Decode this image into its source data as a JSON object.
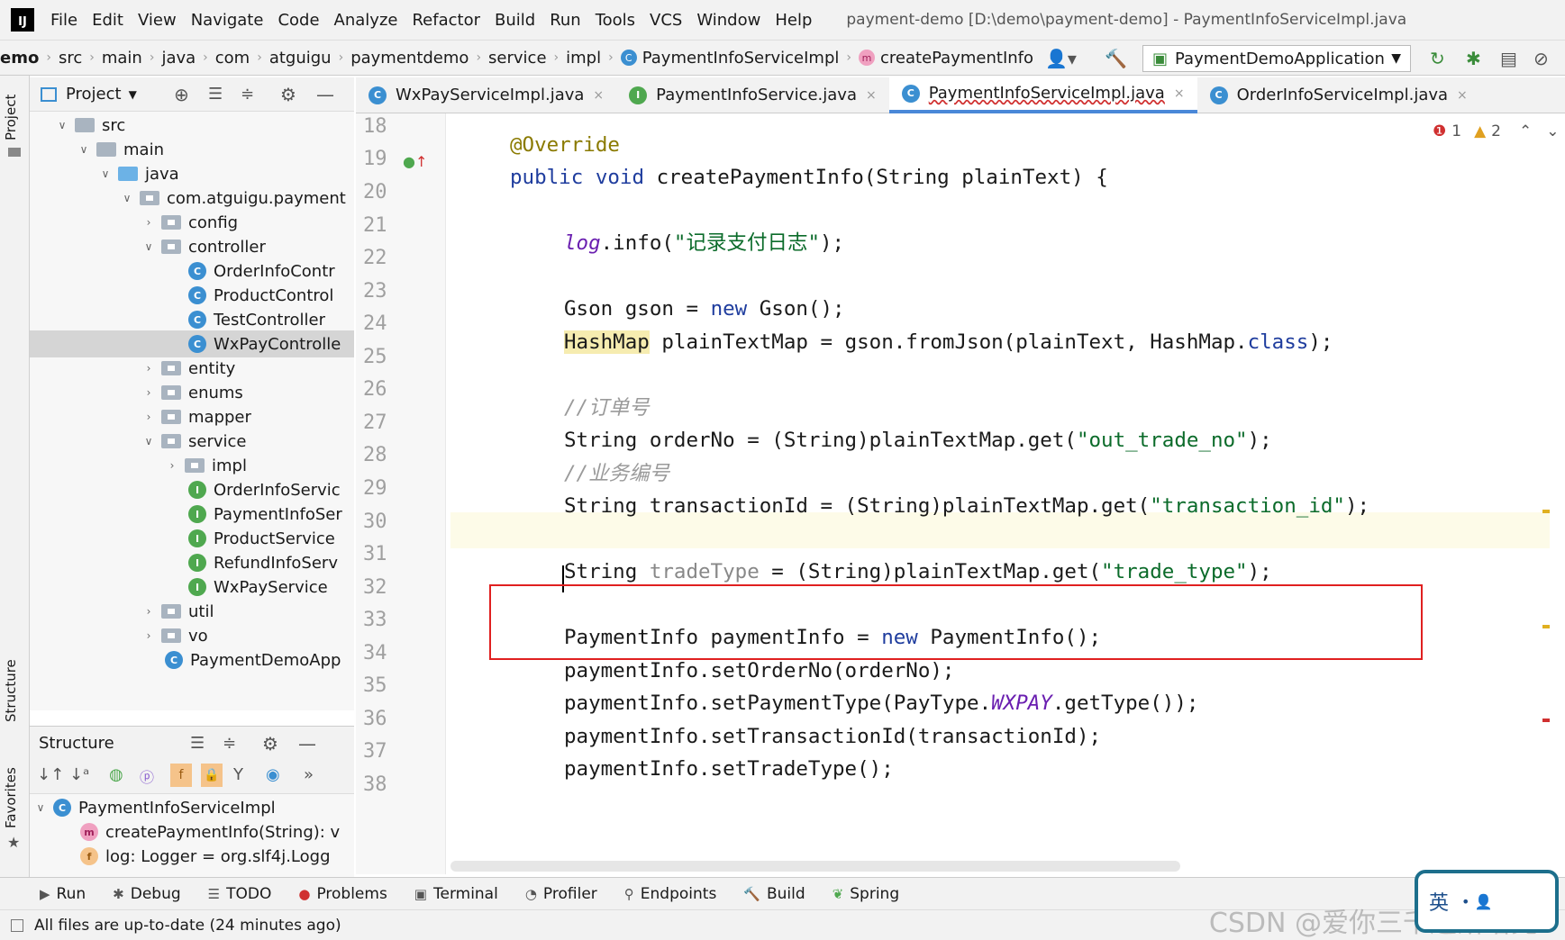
{
  "menubar": {
    "logo": "IJ",
    "items": [
      "File",
      "Edit",
      "View",
      "Navigate",
      "Code",
      "Analyze",
      "Refactor",
      "Build",
      "Run",
      "Tools",
      "VCS",
      "Window",
      "Help"
    ],
    "window_title": "payment-demo [D:\\demo\\payment-demo] - PaymentInfoServiceImpl.java"
  },
  "breadcrumb": [
    "emo",
    "src",
    "main",
    "java",
    "com",
    "atguigu",
    "paymentdemo",
    "service",
    "impl",
    "PaymentInfoServiceImpl",
    "createPaymentInfo"
  ],
  "run_config": "PaymentDemoApplication",
  "project": {
    "title": "Project",
    "rows": [
      {
        "label": "src",
        "depth": 1
      },
      {
        "label": "main",
        "depth": 2
      },
      {
        "label": "java",
        "depth": 3
      },
      {
        "label": "com.atguigu.payment",
        "depth": 4
      },
      {
        "label": "config",
        "depth": 5
      },
      {
        "label": "controller",
        "depth": 5
      },
      {
        "label": "OrderInfoContr",
        "depth": 6
      },
      {
        "label": "ProductControl",
        "depth": 6
      },
      {
        "label": "TestController",
        "depth": 6
      },
      {
        "label": "WxPayControlle",
        "depth": 6
      },
      {
        "label": "entity",
        "depth": 5
      },
      {
        "label": "enums",
        "depth": 5
      },
      {
        "label": "mapper",
        "depth": 5
      },
      {
        "label": "service",
        "depth": 5
      },
      {
        "label": "impl",
        "depth": 6
      },
      {
        "label": "OrderInfoServic",
        "depth": 6
      },
      {
        "label": "PaymentInfoSer",
        "depth": 6
      },
      {
        "label": "ProductService",
        "depth": 6
      },
      {
        "label": "RefundInfoServ",
        "depth": 6
      },
      {
        "label": "WxPayService",
        "depth": 6
      },
      {
        "label": "util",
        "depth": 5
      },
      {
        "label": "vo",
        "depth": 5
      },
      {
        "label": "PaymentDemoApp",
        "depth": 5
      }
    ]
  },
  "left_stripe": {
    "project": "Project",
    "structure": "Structure",
    "favorites": "Favorites"
  },
  "structure": {
    "title": "Structure",
    "rows": [
      "PaymentInfoServiceImpl",
      "createPaymentInfo(String): v",
      "log: Logger = org.slf4j.Logg"
    ]
  },
  "tabs": [
    {
      "label": "WxPayServiceImpl.java",
      "badge": "C"
    },
    {
      "label": "PaymentInfoService.java",
      "badge": "I"
    },
    {
      "label": "PaymentInfoServiceImpl.java",
      "badge": "C"
    },
    {
      "label": "OrderInfoServiceImpl.java",
      "badge": "C"
    }
  ],
  "inspections": {
    "errors": "1",
    "warnings": "2"
  },
  "line_numbers": [
    "18",
    "19",
    "20",
    "21",
    "22",
    "23",
    "24",
    "25",
    "26",
    "27",
    "28",
    "29",
    "30",
    "31",
    "32",
    "33",
    "34",
    "35",
    "36",
    "37",
    "38"
  ],
  "code": {
    "l19": "@Override",
    "l19_public": "public void ",
    "l19_rest": "createPaymentInfo(String plainText) {",
    "l21_a": "log",
    "l21_b": ".info(",
    "l21_str": "\"记录支付日志\"",
    "l21_c": ");",
    "l23_a": "Gson gson = ",
    "l23_new": "new",
    "l23_b": " Gson();",
    "l24_hm": "HashMap",
    "l24_b": " plainTextMap = gson.fromJson(plainText, HashMap.",
    "l24_class": "class",
    "l24_c": ");",
    "l26": "//订单号",
    "l27_a": "String orderNo = (String)plainTextMap.get(",
    "l27_str": "\"out_trade_no\"",
    "l27_b": ");",
    "l28": "//业务编号",
    "l29_a": "String transactionId = (String)plainTextMap.get(",
    "l29_str": "\"transaction_id\"",
    "l29_b": ");",
    "l31_a": "String ",
    "l31_var": "tradeType",
    "l31_b": " = (String)plainTextMap.get(",
    "l31_str": "\"trade_type\"",
    "l31_c": ");",
    "l33_a": "PaymentInfo paymentInfo = ",
    "l33_new": "new",
    "l33_b": " PaymentInfo();",
    "l34": "paymentInfo.setOrderNo(orderNo);",
    "l35_a": "paymentInfo.setPaymentType(PayType.",
    "l35_const": "WXPAY",
    "l35_b": ".getType());",
    "l36": "paymentInfo.setTransactionId(transactionId);",
    "l37": "paymentInfo.setTradeType();"
  },
  "bottom_tools": [
    "Run",
    "Debug",
    "TODO",
    "Problems",
    "Terminal",
    "Profiler",
    "Endpoints",
    "Build",
    "Spring"
  ],
  "status": "All files are up-to-date (24 minutes ago)",
  "watermark": "CSDN @爱你三千遍斯塔克",
  "ime": "英"
}
